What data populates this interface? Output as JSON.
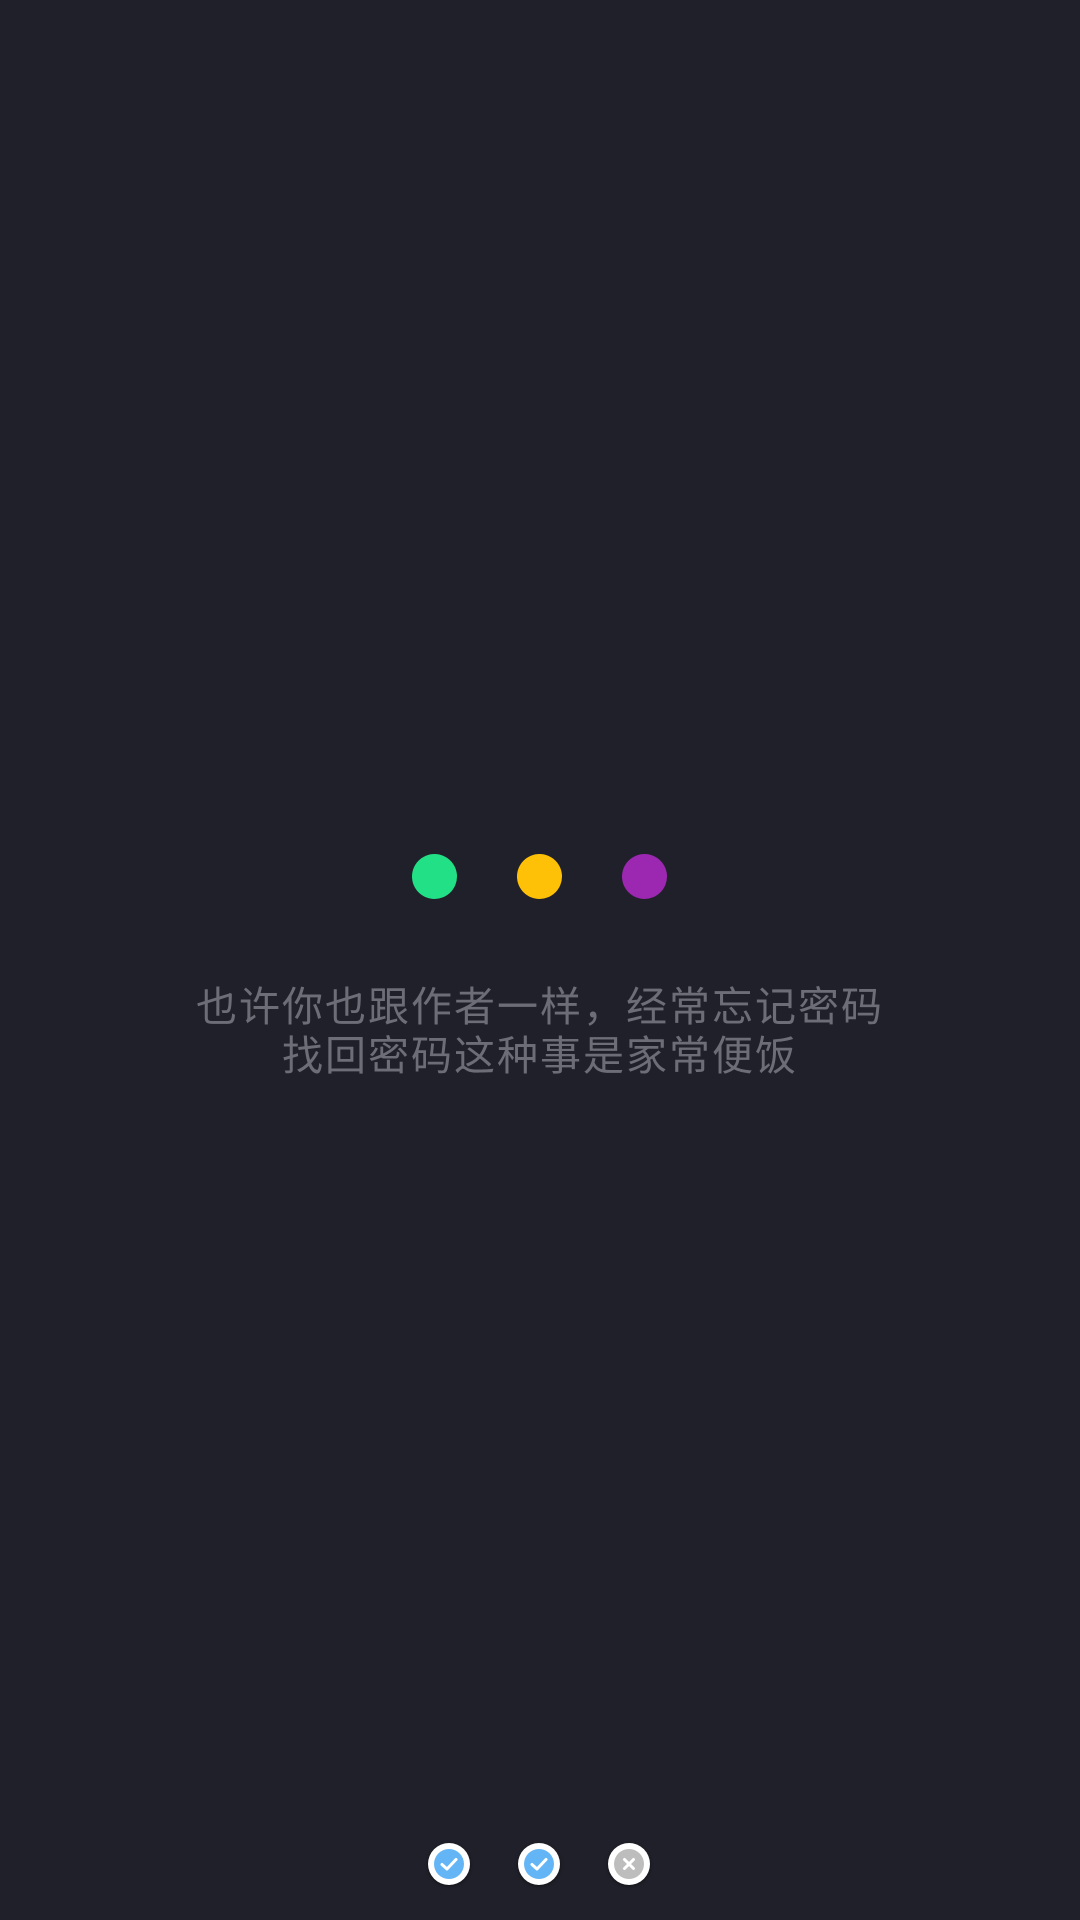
{
  "loading_dots": [
    {
      "name": "green",
      "color": "#22e085"
    },
    {
      "name": "amber",
      "color": "#ffc107"
    },
    {
      "name": "purple",
      "color": "#9c27b0"
    }
  ],
  "message": {
    "line1": "也许你也跟作者一样，经常忘记密码",
    "line2": "找回密码这种事是家常便饭"
  },
  "page_indicators": [
    {
      "state": "done",
      "icon": "check-circle-icon",
      "color": "#64b5f6"
    },
    {
      "state": "done",
      "icon": "check-circle-icon",
      "color": "#64b5f6"
    },
    {
      "state": "pending",
      "icon": "close-circle-icon",
      "color": "#bdbdbd"
    }
  ]
}
